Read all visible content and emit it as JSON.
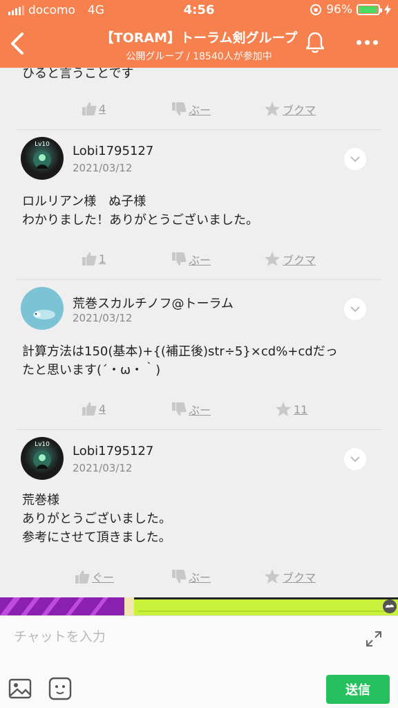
{
  "status_bar": {
    "carrier": "docomo",
    "network": "4G",
    "time": "4:56",
    "battery": "96%",
    "battery_level": 0.96
  },
  "header": {
    "title": "【TORAM】トーラム剣グループ",
    "subtitle": "公開グループ / 18540人が参加中",
    "accent_color": "#f6804e"
  },
  "partial_comment": {
    "text": "ひると言うことです"
  },
  "partial_actions": {
    "like": "4",
    "dislike": "ぶー",
    "bookmark": "ブクマ"
  },
  "comments": [
    {
      "user": "Lobi1795127",
      "date": "2021/03/12",
      "avatar_badge": "Lv10",
      "lines": [
        "ロルリアン様　ぬ子様",
        "わかりました！ありがとうございました。"
      ],
      "actions": {
        "like": "1",
        "dislike": "ぶー",
        "bookmark": "ブクマ"
      }
    },
    {
      "user": "荒巻スカルチノフ@トーラム",
      "date": "2021/03/12",
      "lines": [
        "計算方法は150(基本)+{(補正後)str÷5}×cd%+cdだっ",
        "たと思います(´・ω・｀)"
      ],
      "actions": {
        "like": "4",
        "dislike": "ぶー",
        "bookmark": "11"
      }
    },
    {
      "user": "Lobi1795127",
      "date": "2021/03/12",
      "avatar_badge": "Lv10",
      "lines": [
        "荒巻様",
        "ありがとうございました。",
        "参考にさせて頂きました。"
      ],
      "actions": {
        "like": "ぐー",
        "dislike": "ぶー",
        "bookmark": "ブクマ"
      }
    }
  ],
  "input": {
    "placeholder": "チャットを入力",
    "send_label": "送信"
  },
  "icons": [
    "back-icon",
    "bell-icon",
    "more-icon",
    "like-icon",
    "dislike-icon",
    "bookmark-icon",
    "chevron-down-icon",
    "expand-icon",
    "image-icon",
    "emoji-icon"
  ]
}
